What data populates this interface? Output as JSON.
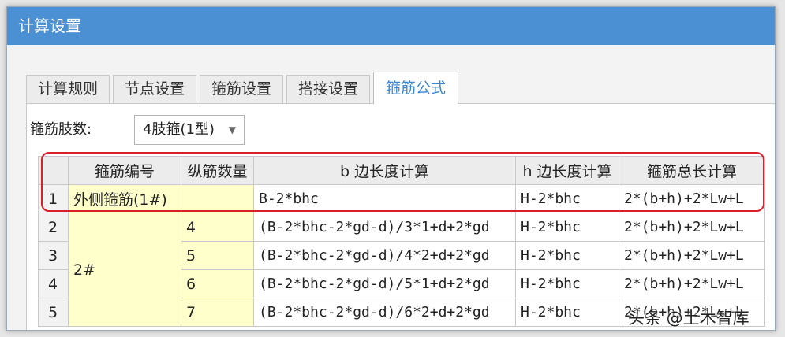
{
  "window": {
    "title": "计算设置"
  },
  "tabs": [
    {
      "label": "计算规则",
      "active": false
    },
    {
      "label": "节点设置",
      "active": false
    },
    {
      "label": "箍筋设置",
      "active": false
    },
    {
      "label": "搭接设置",
      "active": false
    },
    {
      "label": "箍筋公式",
      "active": true
    }
  ],
  "limb": {
    "label": "箍筋肢数:",
    "value": "4肢箍(1型)"
  },
  "grid": {
    "headers": [
      "",
      "箍筋编号",
      "纵筋数量",
      "b 边长度计算",
      "h 边长度计算",
      "箍筋总长计算"
    ],
    "rows": [
      {
        "num": "1",
        "code": "外侧箍筋(1#)",
        "count": "",
        "b": "B-2*bhc",
        "h": "H-2*bhc",
        "total": "2*(b+h)+2*Lw+L"
      },
      {
        "num": "2",
        "code": "2#",
        "count": "4",
        "b": "(B-2*bhc-2*gd-d)/3*1+d+2*gd",
        "h": "H-2*bhc",
        "total": "2*(b+h)+2*Lw+L"
      },
      {
        "num": "3",
        "count": "5",
        "b": "(B-2*bhc-2*gd-d)/4*2+d+2*gd",
        "h": "H-2*bhc",
        "total": "2*(b+h)+2*Lw+L"
      },
      {
        "num": "4",
        "count": "6",
        "b": "(B-2*bhc-2*gd-d)/5*1+d+2*gd",
        "h": "H-2*bhc",
        "total": "2*(b+h)+2*Lw+L"
      },
      {
        "num": "5",
        "count": "7",
        "b": "(B-2*bhc-2*gd-d)/6*2+d+2*gd",
        "h": "H-2*bhc",
        "total": "2*(b+h)+2*Lw+L"
      }
    ]
  },
  "watermark": "头条 @土木智库",
  "colors": {
    "titlebar": "#4a90d2",
    "highlight": "#d8202a",
    "code_cell": "#ffffcc",
    "active_tab_text": "#3b87d6"
  }
}
